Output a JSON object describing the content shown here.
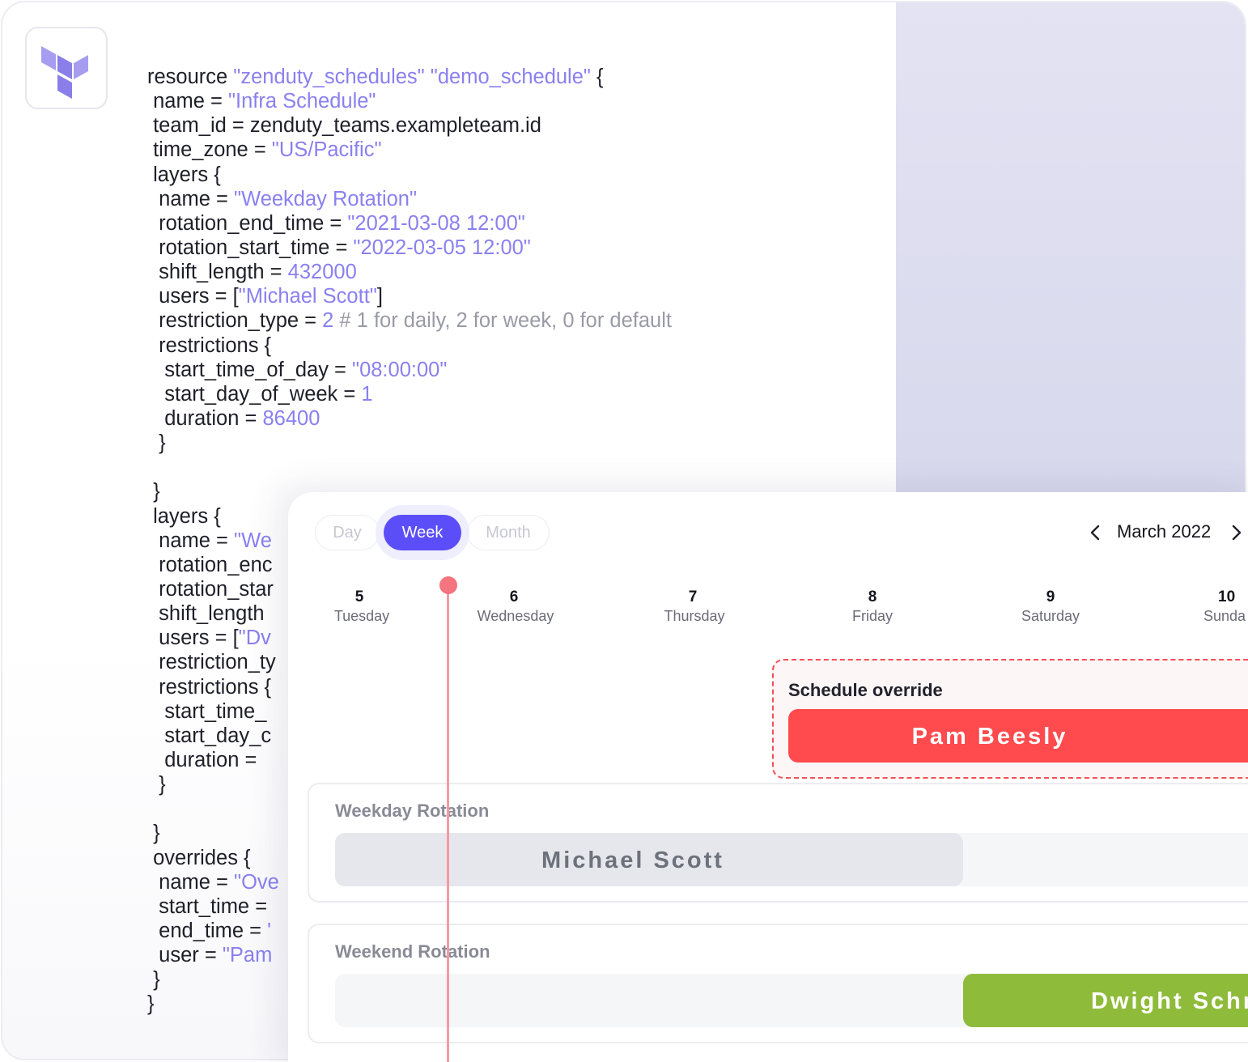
{
  "code": {
    "lines": [
      [
        {
          "t": "resource "
        },
        {
          "t": "\"zenduty_schedules\" \"demo_schedule\"",
          "k": "s"
        },
        {
          "t": " {"
        }
      ],
      [
        {
          "t": " name = "
        },
        {
          "t": "\"Infra Schedule\"",
          "k": "s"
        }
      ],
      [
        {
          "t": " team_id = zenduty_teams.exampleteam.id"
        }
      ],
      [
        {
          "t": " time_zone = "
        },
        {
          "t": "\"US/Pacific\"",
          "k": "s"
        }
      ],
      [
        {
          "t": " layers {"
        }
      ],
      [
        {
          "t": "  name = "
        },
        {
          "t": "\"Weekday Rotation\"",
          "k": "s"
        }
      ],
      [
        {
          "t": "  rotation_end_time = "
        },
        {
          "t": "\"2021-03-08 12:00\"",
          "k": "s"
        }
      ],
      [
        {
          "t": "  rotation_start_time = "
        },
        {
          "t": "\"2022-03-05 12:00\"",
          "k": "s"
        }
      ],
      [
        {
          "t": "  shift_length = "
        },
        {
          "t": "432000",
          "k": "s"
        }
      ],
      [
        {
          "t": "  users = ["
        },
        {
          "t": "\"Michael Scott\"",
          "k": "s"
        },
        {
          "t": "]"
        }
      ],
      [
        {
          "t": "  restriction_type = "
        },
        {
          "t": "2",
          "k": "s"
        },
        {
          "t": " # 1 for daily, 2 for week, 0 for default",
          "k": "c"
        }
      ],
      [
        {
          "t": "  restrictions {"
        }
      ],
      [
        {
          "t": "   start_time_of_day = "
        },
        {
          "t": "\"08:00:00\"",
          "k": "s"
        }
      ],
      [
        {
          "t": "   start_day_of_week = "
        },
        {
          "t": "1",
          "k": "s"
        }
      ],
      [
        {
          "t": "   duration = "
        },
        {
          "t": "86400",
          "k": "s"
        }
      ],
      [
        {
          "t": "  }"
        }
      ],
      [
        {
          "t": ""
        }
      ],
      [
        {
          "t": " }"
        }
      ],
      [
        {
          "t": " layers {"
        }
      ],
      [
        {
          "t": "  name = "
        },
        {
          "t": "\"We",
          "k": "s"
        }
      ],
      [
        {
          "t": "  rotation_enc"
        }
      ],
      [
        {
          "t": "  rotation_star"
        }
      ],
      [
        {
          "t": "  shift_length"
        }
      ],
      [
        {
          "t": "  users = ["
        },
        {
          "t": "\"Dv",
          "k": "s"
        }
      ],
      [
        {
          "t": "  restriction_ty"
        }
      ],
      [
        {
          "t": "  restrictions {"
        }
      ],
      [
        {
          "t": "   start_time_"
        }
      ],
      [
        {
          "t": "   start_day_c"
        }
      ],
      [
        {
          "t": "   duration ="
        }
      ],
      [
        {
          "t": "  }"
        }
      ],
      [
        {
          "t": ""
        }
      ],
      [
        {
          "t": " }"
        }
      ],
      [
        {
          "t": " overrides {"
        }
      ],
      [
        {
          "t": "  name = "
        },
        {
          "t": "\"Ove",
          "k": "s"
        }
      ],
      [
        {
          "t": "  start_time ="
        }
      ],
      [
        {
          "t": "  end_time = "
        },
        {
          "t": "'",
          "k": "s"
        }
      ],
      [
        {
          "t": "  user = "
        },
        {
          "t": "\"Pam",
          "k": "s"
        }
      ],
      [
        {
          "t": " }"
        }
      ],
      [
        {
          "t": "}"
        }
      ]
    ]
  },
  "calendar": {
    "view_tabs": [
      {
        "label": "Day",
        "active": false
      },
      {
        "label": "Week",
        "active": true
      },
      {
        "label": "Month",
        "active": false
      }
    ],
    "month_label": "March 2022",
    "days": [
      {
        "num": "5",
        "name": "Tuesday"
      },
      {
        "num": "6",
        "name": "Wednesday"
      },
      {
        "num": "7",
        "name": "Thursday"
      },
      {
        "num": "8",
        "name": "Friday"
      },
      {
        "num": "9",
        "name": "Saturday"
      },
      {
        "num": "10",
        "name": "Sunda"
      }
    ],
    "override": {
      "title": "Schedule override",
      "user": "Pam Beesly"
    },
    "weekday_rotation": {
      "title": "Weekday Rotation",
      "user": "Michael Scott"
    },
    "weekend_rotation": {
      "title": "Weekend Rotation",
      "user": "Dwight Schr"
    }
  },
  "colors": {
    "accent": "#5b4ef8",
    "code_string": "#8a80f0",
    "override_red": "#ff4a4e",
    "weekend_green": "#8fbb3a",
    "now_indicator": "#f47480"
  },
  "icons": [
    "terraform-logo-icon",
    "chevron-left-icon",
    "chevron-right-icon"
  ]
}
